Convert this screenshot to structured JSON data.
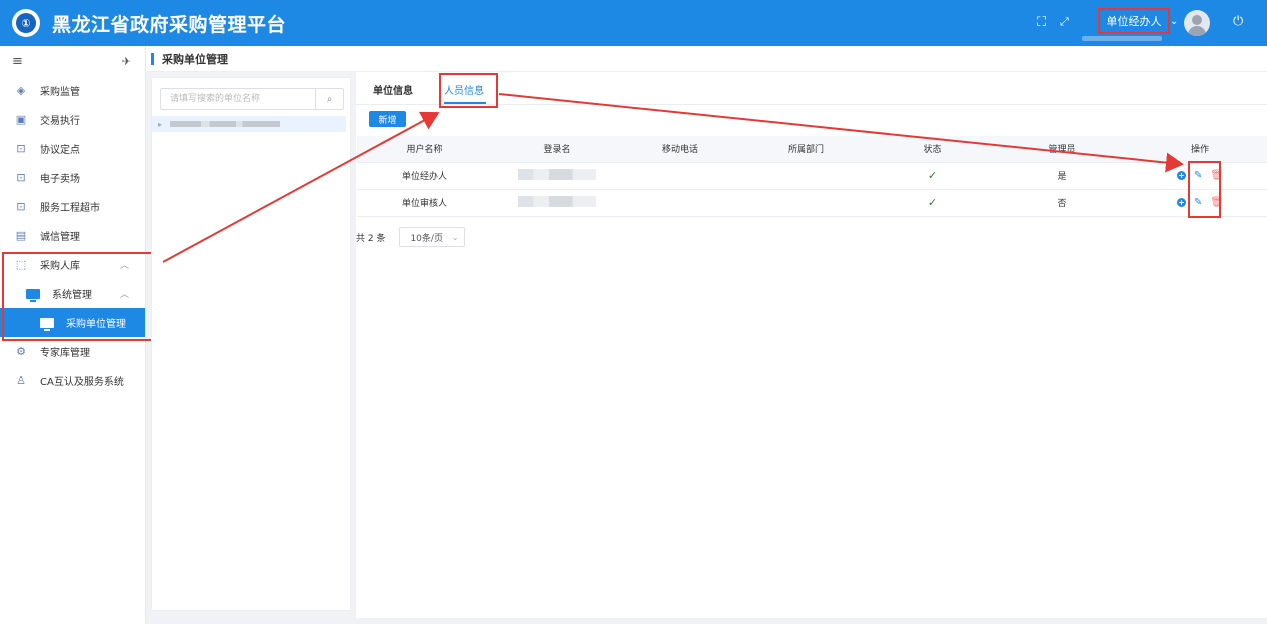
{
  "header": {
    "logo_text": "①",
    "title": "黑龙江省政府采购管理平台",
    "user_name": "单位经办人",
    "colors": {
      "primary": "#1e88e5",
      "annotation": "#e53935"
    }
  },
  "sidebar": {
    "items": [
      {
        "label": "采购监管",
        "icon": "shield-icon"
      },
      {
        "label": "交易执行",
        "icon": "clipboard-icon"
      },
      {
        "label": "协议定点",
        "icon": "store-icon"
      },
      {
        "label": "电子卖场",
        "icon": "store-icon"
      },
      {
        "label": "服务工程超市",
        "icon": "store-icon"
      },
      {
        "label": "诚信管理",
        "icon": "card-icon"
      },
      {
        "label": "采购人库",
        "icon": "folder-icon"
      },
      {
        "label": "系统管理",
        "icon": "monitor-icon"
      },
      {
        "label": "采购单位管理",
        "icon": "monitor-icon"
      },
      {
        "label": "专家库管理",
        "icon": "gear-icon"
      },
      {
        "label": "CA互认及服务系统",
        "icon": "user-icon"
      }
    ]
  },
  "breadcrumb": {
    "title": "采购单位管理"
  },
  "tree": {
    "search_placeholder": "请填写搜索的单位名称"
  },
  "tabs": [
    {
      "label": "单位信息"
    },
    {
      "label": "人员信息"
    }
  ],
  "toolbar": {
    "add_label": "新增"
  },
  "table": {
    "headers": [
      "用户名称",
      "登录名",
      "移动电话",
      "所属部门",
      "状态",
      "管理员",
      "操作"
    ],
    "rows": [
      {
        "name": "单位经办人",
        "admin": "是"
      },
      {
        "name": "单位审核人",
        "admin": "否"
      }
    ]
  },
  "pagination": {
    "total_text": "共 2 条",
    "page_size": "10条/页"
  }
}
